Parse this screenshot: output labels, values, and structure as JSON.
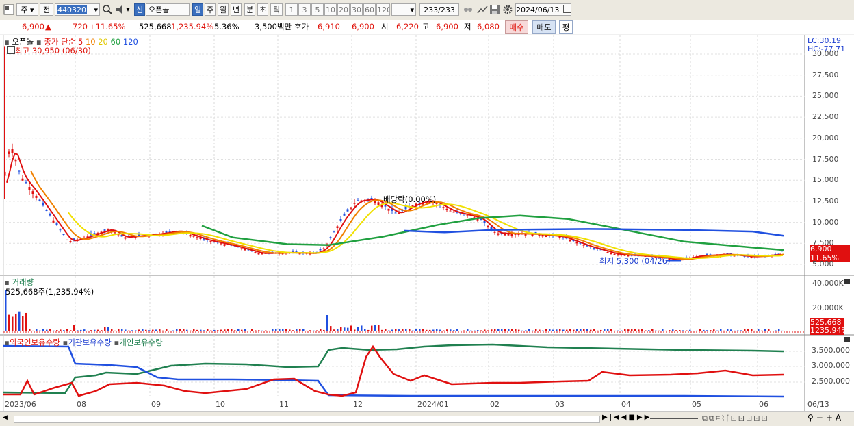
{
  "toolbar": {
    "stock_mode": "주",
    "market_btn": "전",
    "code": "440320",
    "new_badge": "신",
    "name": "오픈놀",
    "periods": [
      "일",
      "주",
      "월",
      "년",
      "분",
      "초",
      "틱"
    ],
    "selected_period": "일",
    "intervals": [
      "1",
      "3",
      "5",
      "10",
      "20",
      "30",
      "60",
      "120"
    ],
    "count": "233",
    "count_total": "/233",
    "date": "2024/06/13"
  },
  "info": {
    "price": "6,900",
    "change": "720",
    "change_pct": "+11.65%",
    "volume": "525,668",
    "volume_pct": "1,235.94%",
    "turnover_pct": "5.36%",
    "amount": "3,500백만",
    "hoga_label": "호가",
    "ask": "6,910",
    "bid": "6,900",
    "open_label": "시",
    "open": "6,220",
    "high_label": "고",
    "high": "6,900",
    "low_label": "저",
    "low": "6,080",
    "buy_button": "매수",
    "sell_button": "매도",
    "eval_button": "평"
  },
  "price_pane": {
    "legend_name": "오픈놀",
    "legend_ma": "종가 단순",
    "ma_periods": [
      "5",
      "10",
      "20",
      "60",
      "120"
    ],
    "ma_colors": [
      "#e01010",
      "#f08000",
      "#f0e000",
      "#20a040",
      "#2050e0"
    ],
    "high_note": "최고 30,950 (06/30)",
    "low_note": "최저 5,300 (04/26)",
    "dividend_note": "배당락(0.00%)",
    "lc": "LC:30.19",
    "hc": "HC:-77.71",
    "price_tag": "6,900",
    "pct_tag": "11.65%",
    "y_ticks": [
      "30,000",
      "27,500",
      "25,000",
      "22,500",
      "20,000",
      "17,500",
      "15,000",
      "12,500",
      "10,000",
      "7,500",
      "5,000"
    ]
  },
  "volume_pane": {
    "title": "거래량",
    "value": "525,668주(1,235.94%)",
    "y_ticks": [
      "40,000K",
      "20,000K"
    ],
    "tag_value": "525,668",
    "tag_pct": "1235.94%"
  },
  "holding_pane": {
    "series": [
      "외국인보유수량",
      "기관보유수량",
      "개인보유수량"
    ],
    "series_colors": [
      "#e01010",
      "#2050e0",
      "#208050"
    ],
    "y_ticks": [
      "3,500,000",
      "3,000,000",
      "2,500,000"
    ]
  },
  "x_axis": [
    "2023/06",
    "08",
    "09",
    "10",
    "11",
    "12",
    "2024/01",
    "02",
    "03",
    "04",
    "05",
    "06",
    "06/13"
  ],
  "chart_data": {
    "type": "line",
    "title": "오픈놀 일봉",
    "price_ylim": [
      5000,
      30000
    ],
    "close_approx": [
      {
        "month": "2023/06",
        "value": 14000
      },
      {
        "month": "2023/07",
        "value": 8000
      },
      {
        "month": "2023/08",
        "value": 8500
      },
      {
        "month": "2023/09",
        "value": 8200
      },
      {
        "month": "2023/10",
        "value": 6500
      },
      {
        "month": "2023/11",
        "value": 6200
      },
      {
        "month": "2023/12",
        "value": 12500
      },
      {
        "month": "2024/01",
        "value": 11500
      },
      {
        "month": "2024/02",
        "value": 8800
      },
      {
        "month": "2024/03",
        "value": 7500
      },
      {
        "month": "2024/04",
        "value": 5500
      },
      {
        "month": "2024/05",
        "value": 6200
      },
      {
        "month": "2024/06",
        "value": 6900
      }
    ]
  }
}
